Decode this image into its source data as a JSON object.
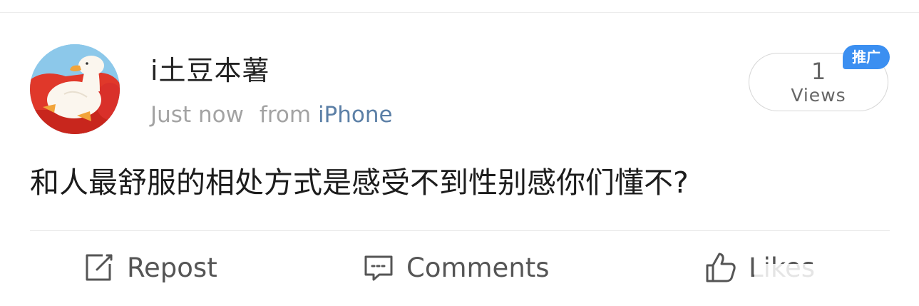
{
  "post": {
    "username": "i土豆本薯",
    "timestamp": "Just now",
    "source_prefix": "from",
    "source": "iPhone",
    "text": "和人最舒服的相处方式是感受不到性别感你们懂不?",
    "avatar_icon": "cartoon-duck-on-red-sofa-avatar"
  },
  "views": {
    "count": "1",
    "label": "Views",
    "badge": "推广"
  },
  "actions": {
    "repost": {
      "label": "Repost",
      "icon": "edit-icon"
    },
    "comments": {
      "label": "Comments",
      "icon": "comment-icon"
    },
    "likes": {
      "label": "Likes",
      "icon": "thumbs-up-icon"
    }
  },
  "colors": {
    "source_link": "#5b7fa6",
    "badge_bg": "#3b8ff1",
    "meta_gray": "#a3a3a3",
    "action_gray": "#555555"
  }
}
